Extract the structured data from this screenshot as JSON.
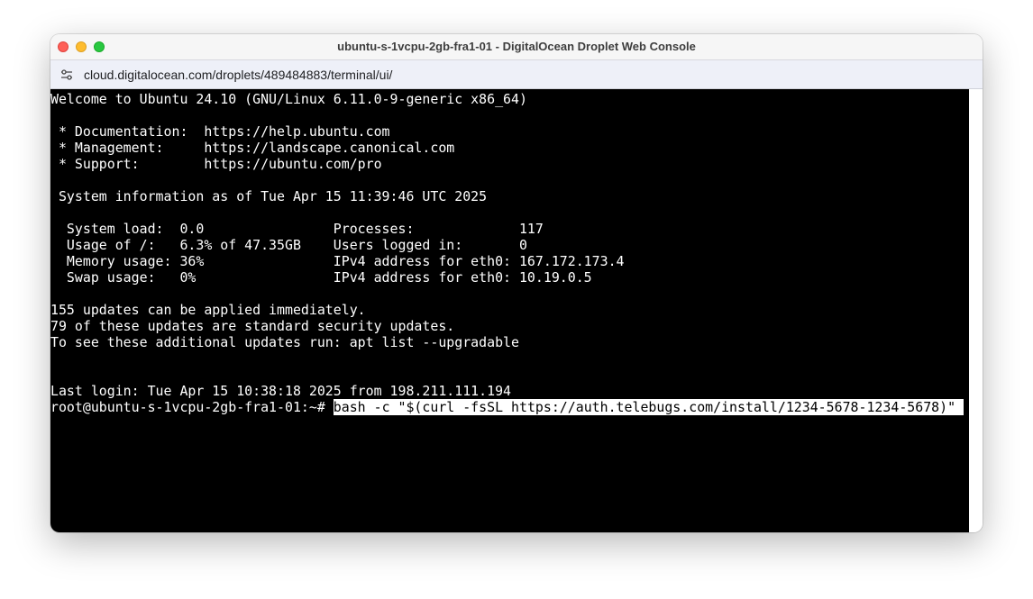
{
  "window": {
    "title": "ubuntu-s-1vcpu-2gb-fra1-01 - DigitalOcean Droplet Web Console"
  },
  "address_bar": {
    "url": "cloud.digitalocean.com/droplets/489484883/terminal/ui/",
    "site_icon": "site-settings-icon"
  },
  "terminal": {
    "lines": [
      "Welcome to Ubuntu 24.10 (GNU/Linux 6.11.0-9-generic x86_64)",
      "",
      " * Documentation:  https://help.ubuntu.com",
      " * Management:     https://landscape.canonical.com",
      " * Support:        https://ubuntu.com/pro",
      "",
      " System information as of Tue Apr 15 11:39:46 UTC 2025",
      "",
      "  System load:  0.0                Processes:             117",
      "  Usage of /:   6.3% of 47.35GB    Users logged in:       0",
      "  Memory usage: 36%                IPv4 address for eth0: 167.172.173.4",
      "  Swap usage:   0%                 IPv4 address for eth0: 10.19.0.5",
      "",
      "155 updates can be applied immediately.",
      "79 of these updates are standard security updates.",
      "To see these additional updates run: apt list --upgradable",
      "",
      "",
      "Last login: Tue Apr 15 10:38:18 2025 from 198.211.111.194"
    ],
    "prompt": "root@ubuntu-s-1vcpu-2gb-fra1-01:~# ",
    "command": "bash -c \"$(curl -fsSL https://auth.telebugs.com/install/1234-5678-1234-5678)\""
  },
  "colors": {
    "terminal_bg": "#000000",
    "terminal_fg": "#ffffff",
    "selection_bg": "#ffffff",
    "close": "#fe5f57",
    "minimize": "#febc2e",
    "maximize": "#28c840"
  }
}
